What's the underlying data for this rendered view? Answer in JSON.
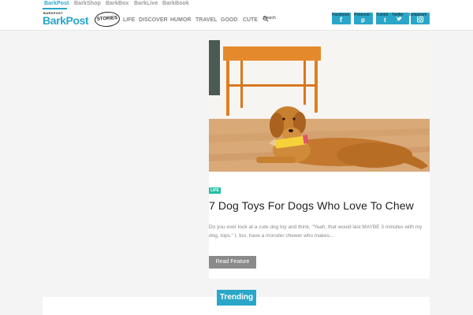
{
  "network": {
    "items": [
      {
        "label": "BarkPost",
        "active": true
      },
      {
        "label": "BarkShop",
        "active": false
      },
      {
        "label": "BarkBox",
        "active": false
      },
      {
        "label": "BarkLive",
        "active": false
      },
      {
        "label": "BarkBook",
        "active": false
      }
    ]
  },
  "header": {
    "logo_small": "BARKPOST",
    "logo": "BarkPost",
    "stories": "STORIES",
    "nav": [
      "LIFE",
      "DISCOVER",
      "HUMOR",
      "TRAVEL",
      "GOOD",
      "CUTE"
    ],
    "search_label": "Search",
    "social": [
      {
        "label": "Facebook",
        "icon": "facebook-icon"
      },
      {
        "label": "Pinterest",
        "icon": "pinterest-icon"
      },
      {
        "label": "Tumblr",
        "icon": "tumblr-icon"
      },
      {
        "label": "Twitter",
        "icon": "twitter-icon"
      },
      {
        "label": "Instagram",
        "icon": "instagram-icon"
      }
    ]
  },
  "feature": {
    "tag": "LIFE",
    "title": "7 Dog Toys For Dogs Who Love To Chew",
    "excerpt": "Do you ever look at a cute dog toy and think, \"Yeah, that would last MAYBE 3 minutes with my dog, tops.\" I, too, have a monster chewer who makes...",
    "button": "Read Feature"
  },
  "trending": {
    "label": "Trending"
  },
  "colors": {
    "brand": "#2aa6c9",
    "tag": "#1ec0a6",
    "button": "#8a8a8a"
  }
}
